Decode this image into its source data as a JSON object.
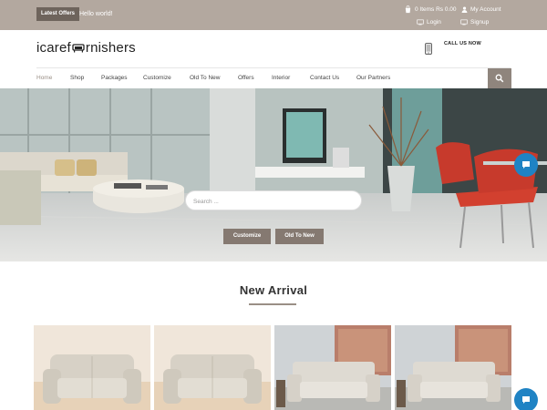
{
  "topbar": {
    "latest_label": "Latest Offers",
    "ticker_text": "Hello world!",
    "cart_text": "0 Items Rs 0.00",
    "account_label": "My Account",
    "login_label": "Login",
    "signup_label": "Signup"
  },
  "header": {
    "logo_left": "icaref",
    "logo_right": "rnishers",
    "call_label": "CALL US NOW"
  },
  "nav": {
    "items": [
      {
        "label": "Home"
      },
      {
        "label": "Shop"
      },
      {
        "label": "Packages"
      },
      {
        "label": "Customize"
      },
      {
        "label": "Old To New"
      },
      {
        "label": "Offers"
      },
      {
        "label": "Interior"
      },
      {
        "label": "Contact Us"
      },
      {
        "label": "Our Partners"
      }
    ],
    "active": "Home"
  },
  "hero": {
    "search_placeholder": "Search ...",
    "customize_button": "Customize",
    "old_to_new_button": "Old To New"
  },
  "new_arrival": {
    "title": "New Arrival"
  },
  "colors": {
    "topbar_bg": "#b3a89f",
    "accent_brown": "#857971",
    "chat_blue": "#1f83c4"
  },
  "icons": [
    "cart-icon",
    "user-icon",
    "login-icon",
    "signup-icon",
    "phone-icon",
    "search-icon",
    "chat-icon"
  ]
}
